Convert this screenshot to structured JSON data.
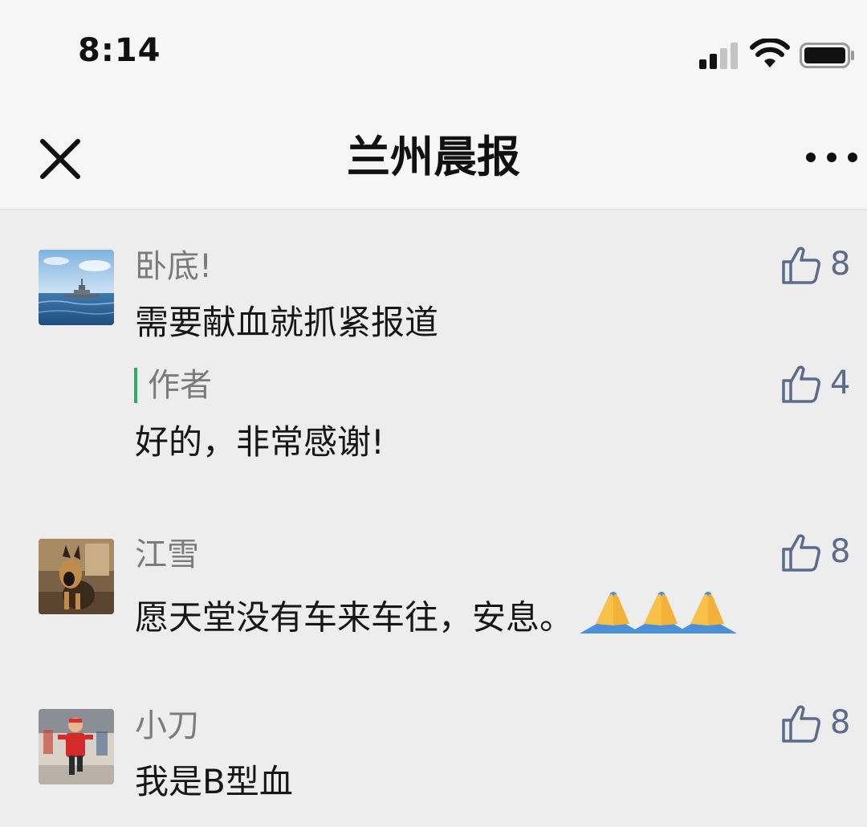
{
  "status_bar": {
    "time": "8:14",
    "signal_icon": "cellular-signal-icon",
    "wifi_icon": "wifi-icon",
    "battery_icon": "battery-icon"
  },
  "nav": {
    "close_icon": "close-icon",
    "title": "兰州晨报",
    "more_icon": "more-dots-icon"
  },
  "comments": [
    {
      "nickname": "卧底!",
      "text": "需要献血就抓紧报道",
      "likes": "8",
      "avatar": "battleship-avatar",
      "reply": {
        "label": "作者",
        "text": "好的，非常感谢!",
        "likes": "4"
      }
    },
    {
      "nickname": "江雪",
      "text": "愿天堂没有车来车往，安息。",
      "emoji": "🙏🙏🙏",
      "likes": "8",
      "avatar": "dog-avatar"
    },
    {
      "nickname": "小刀",
      "text": "我是B型血",
      "likes": "8",
      "avatar": "child-runner-avatar"
    }
  ],
  "colors": {
    "background": "#ededed",
    "header_background": "#f6f6f6",
    "like_color": "#5b6b8c",
    "author_bar": "#2aae67",
    "nickname": "#7b7b7b"
  }
}
